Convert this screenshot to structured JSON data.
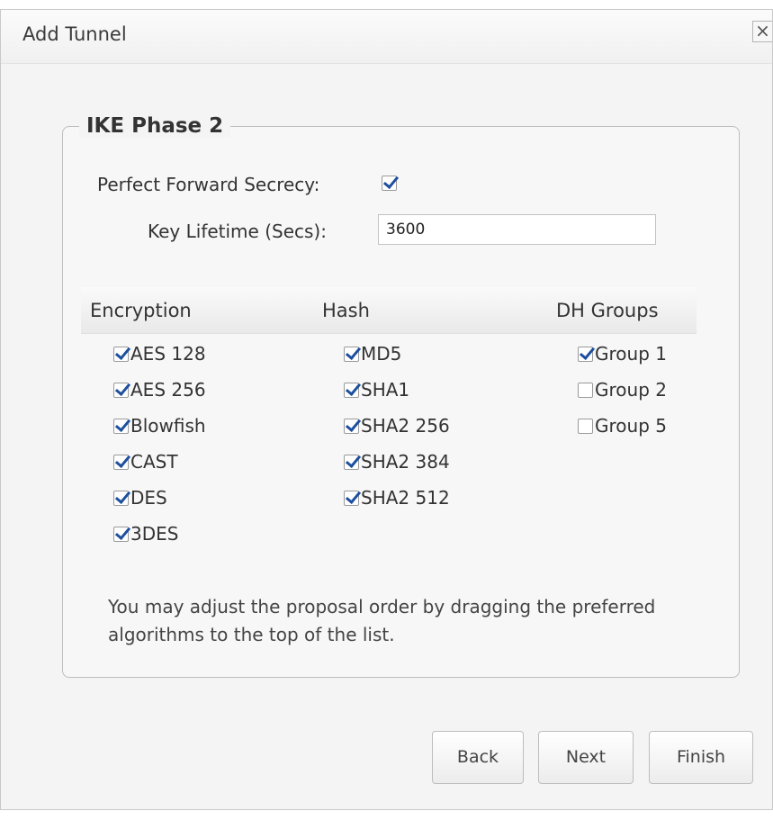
{
  "dialog": {
    "title": "Add Tunnel",
    "close_glyph": "×"
  },
  "fieldset": {
    "legend": "IKE Phase 2",
    "pfs_label": "Perfect Forward Secrecy:",
    "pfs_checked": true,
    "key_lifetime_label": "Key Lifetime (Secs):",
    "key_lifetime_value": "3600"
  },
  "columns": {
    "encryption": {
      "header": "Encryption",
      "items": [
        {
          "label": "AES 128",
          "checked": true
        },
        {
          "label": "AES 256",
          "checked": true
        },
        {
          "label": "Blowfish",
          "checked": true
        },
        {
          "label": "CAST",
          "checked": true
        },
        {
          "label": "DES",
          "checked": true
        },
        {
          "label": "3DES",
          "checked": true
        }
      ]
    },
    "hash": {
      "header": "Hash",
      "items": [
        {
          "label": "MD5",
          "checked": true
        },
        {
          "label": "SHA1",
          "checked": true
        },
        {
          "label": "SHA2 256",
          "checked": true
        },
        {
          "label": "SHA2 384",
          "checked": true
        },
        {
          "label": "SHA2 512",
          "checked": true
        }
      ]
    },
    "dh_groups": {
      "header": "DH Groups",
      "items": [
        {
          "label": "Group 1",
          "checked": true
        },
        {
          "label": "Group 2",
          "checked": false
        },
        {
          "label": "Group 5",
          "checked": false
        }
      ]
    }
  },
  "hint": "You may adjust the proposal order by dragging the preferred algorithms to the top of the list.",
  "buttons": {
    "back": "Back",
    "next": "Next",
    "finish": "Finish"
  },
  "colors": {
    "check_mark": "#1d4f9e",
    "dialog_bg": "#f4f4f4"
  }
}
